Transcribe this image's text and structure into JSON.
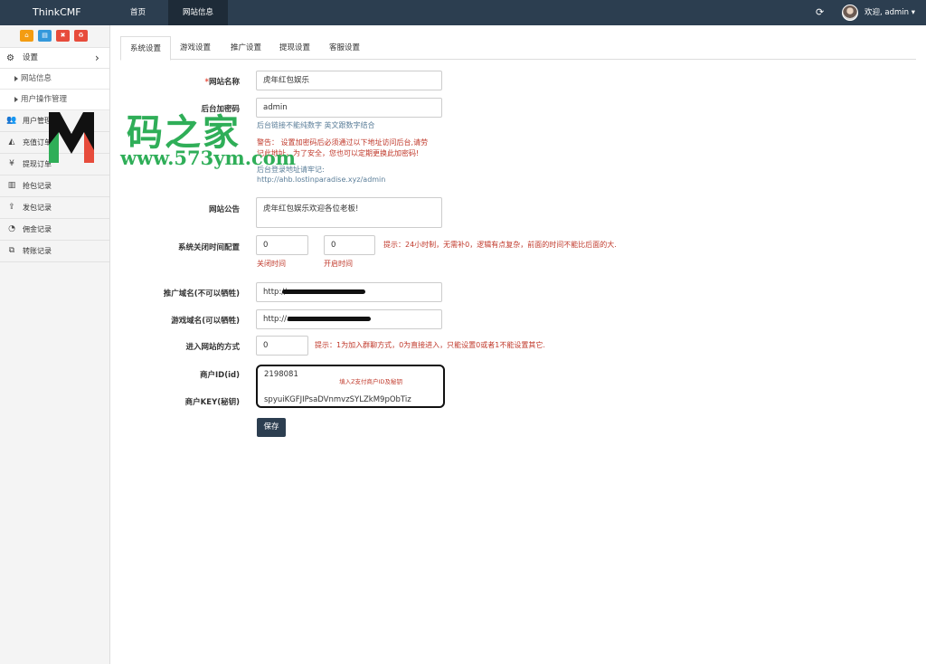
{
  "topbar": {
    "brand": "ThinkCMF",
    "nav": [
      "首页",
      "网站信息"
    ],
    "welcome": "欢迎, admin ▾"
  },
  "sidebar": {
    "settings_label": "设置",
    "submenu": [
      "网站信息",
      "用户操作管理"
    ],
    "items": [
      {
        "label": "用户管理",
        "icon": "users-icon"
      },
      {
        "label": "充值订单",
        "icon": "chart-area-icon"
      },
      {
        "label": "提现订单",
        "icon": "yen-icon"
      },
      {
        "label": "抢包记录",
        "icon": "bar-chart-icon"
      },
      {
        "label": "发包记录",
        "icon": "upload-icon"
      },
      {
        "label": "佣金记录",
        "icon": "pie-chart-icon"
      },
      {
        "label": "转账记录",
        "icon": "clone-icon"
      }
    ]
  },
  "tabs": [
    "系统设置",
    "游戏设置",
    "推广设置",
    "提现设置",
    "客服设置"
  ],
  "form": {
    "site_name": {
      "label": "网站名称",
      "required_mark": "*",
      "value": "虎年红包娱乐"
    },
    "admin_password": {
      "label": "后台加密码",
      "value": "admin",
      "help": "后台链接不能纯数字 英文跟数字结合",
      "warning_line1": "警告：  设置加密码后必须通过以下地址访问后台,请劳",
      "warning_line2": "记此地址，为了安全，您也可以定期更换此加密码!",
      "login_hint": "后台登录地址请牢记:",
      "login_url": "http://ahb.lostinparadise.xyz/admin"
    },
    "announcement": {
      "label": "网站公告",
      "value": "虎年红包娱乐欢迎各位老板!"
    },
    "close_time": {
      "label": "系统关闭时间配置",
      "close_value": "0",
      "open_value": "0",
      "close_caption": "关闭时间",
      "open_caption": "开启时间",
      "tip": "提示：24小时制，无需补0，逻辑有点复杂，前面的时间不能比后面的大."
    },
    "promo_domain": {
      "label": "推广域名(不可以牺牲)",
      "value": "http://"
    },
    "game_domain": {
      "label": "游戏域名(可以牺牲)",
      "value": "http://a"
    },
    "entry_mode": {
      "label": "进入网站的方式",
      "value": "0",
      "tip": "提示：1为加入群聊方式，0为直接进入，只能设置0或者1不能设置其它."
    },
    "merchant_id": {
      "label": "商户ID(id)",
      "value": "2198081"
    },
    "merchant_key": {
      "label": "商户KEY(秘钥)",
      "value": "spyuiKGFJIPsaDVnmvzSYLZkM9pObTiz"
    },
    "merchant_note": "填入Z支付商户ID及秘钥",
    "save_label": "保存"
  },
  "watermark": {
    "logo": "M",
    "title": "码之家",
    "url": "www.573ym.com"
  }
}
